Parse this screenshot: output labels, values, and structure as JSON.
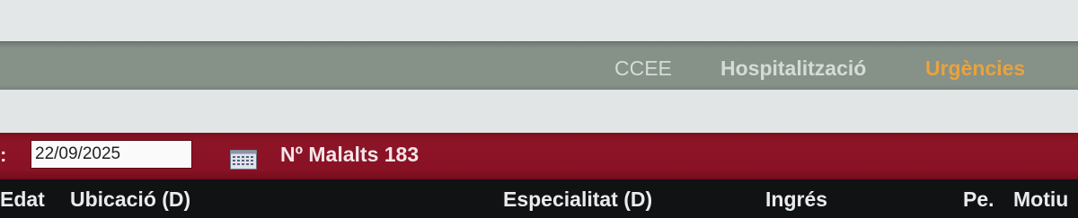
{
  "nav": {
    "tabs": [
      {
        "label": "CCEE",
        "active": false
      },
      {
        "label": "Hospitalització",
        "active": false
      },
      {
        "label": "Urgències",
        "active": true
      }
    ],
    "active_color": "#e8a33d"
  },
  "filter": {
    "date_label": ":",
    "date_value": "22/09/2025",
    "calendar_icon": "calendar-icon",
    "patient_count_text": "Nº Malalts 183",
    "bar_color": "#8a1225"
  },
  "table": {
    "columns": [
      "Edat",
      "Ubicació (D)",
      "Especialitat (D)",
      "Ingrés",
      "Pe.",
      "Motiu"
    ]
  }
}
